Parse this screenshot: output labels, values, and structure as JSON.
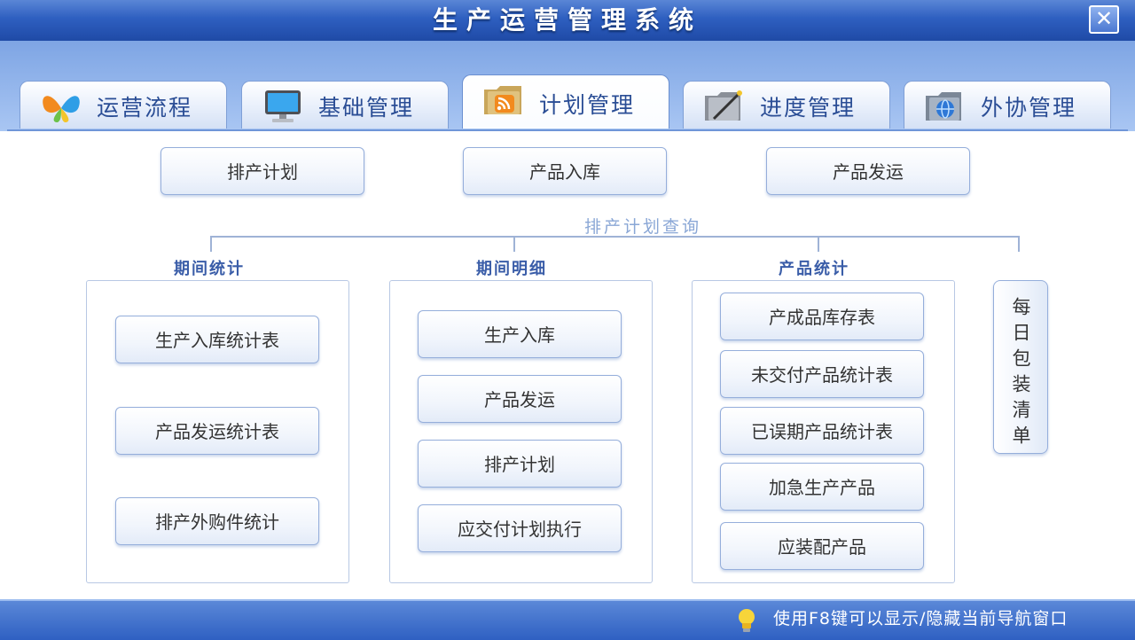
{
  "window": {
    "title": "生产运营管理系统",
    "close_symbol": "✕"
  },
  "tabs": [
    {
      "label": "运营流程",
      "icon": "butterfly-icon",
      "active": false
    },
    {
      "label": "基础管理",
      "icon": "monitor-icon",
      "active": false
    },
    {
      "label": "计划管理",
      "icon": "rss-folder-icon",
      "active": true
    },
    {
      "label": "进度管理",
      "icon": "folder-wand-icon",
      "active": false
    },
    {
      "label": "外协管理",
      "icon": "globe-folder-icon",
      "active": false
    }
  ],
  "top_buttons": [
    "排产计划",
    "产品入库",
    "产品发运"
  ],
  "query_label": "排产计划查询",
  "groups": {
    "period_stats": {
      "title": "期间统计",
      "items": [
        "生产入库统计表",
        "产品发运统计表",
        "排产外购件统计"
      ]
    },
    "period_detail": {
      "title": "期间明细",
      "items": [
        "生产入库",
        "产品发运",
        "排产计划",
        "应交付计划执行"
      ]
    },
    "product_stats": {
      "title": "产品统计",
      "items": [
        "产成品库存表",
        "未交付产品统计表",
        "已误期产品统计表",
        "加急生产产品",
        "应装配产品"
      ]
    }
  },
  "daily_packing": "每日包装清单",
  "status": {
    "icon": "lightbulb-icon",
    "text": "使用F8键可以显示/隐藏当前导航窗口"
  },
  "colors": {
    "title_blue": "#2e5fc0",
    "label_blue": "#2a4d95",
    "accent_orange": "#f28a1e"
  }
}
